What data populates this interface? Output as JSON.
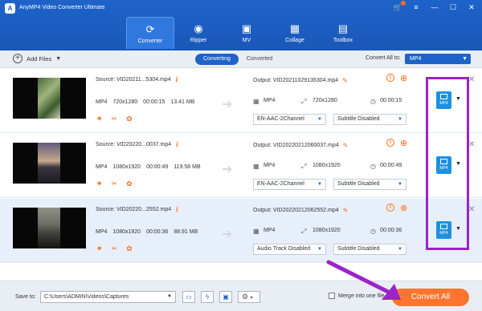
{
  "app": {
    "title": "AnyMP4 Video Converter Ultimate"
  },
  "nav": {
    "tabs": [
      {
        "label": "Converter",
        "icon": "converter-icon",
        "glyph": "⟳"
      },
      {
        "label": "Ripper",
        "icon": "disc-icon",
        "glyph": "◉"
      },
      {
        "label": "MV",
        "icon": "mv-icon",
        "glyph": "▣"
      },
      {
        "label": "Collage",
        "icon": "collage-icon",
        "glyph": "▦"
      },
      {
        "label": "Toolbox",
        "icon": "toolbox-icon",
        "glyph": "▤"
      }
    ]
  },
  "toolbar": {
    "add_files": "Add Files",
    "modes": [
      "Converting",
      "Converted"
    ],
    "convert_all_to_label": "Convert All to:",
    "convert_all_to_value": "MP4"
  },
  "files": [
    {
      "source": "Source: VID20211...5304.mp4",
      "format": "MP4",
      "resolution": "720x1280",
      "duration": "00:00:15",
      "size": "13.41 MB",
      "output": "Output: VID20211029135304.mp4",
      "out_format": "MP4",
      "out_resolution": "720x1280",
      "out_duration": "00:00:15",
      "audio": "EN-AAC-2Channel",
      "subtitle": "Subtitle Disabled",
      "format_badge": "MP4"
    },
    {
      "source": "Source: VID20220...0037.mp4",
      "format": "MP4",
      "resolution": "1080x1920",
      "duration": "00:00:49",
      "size": "119.58 MB",
      "output": "Output: VID20220212060037.mp4",
      "out_format": "MP4",
      "out_resolution": "1080x1920",
      "out_duration": "00:00:49",
      "audio": "EN-AAC-2Channel",
      "subtitle": "Subtitle Disabled",
      "format_badge": "MP4"
    },
    {
      "source": "Source: VID20220...2552.mp4",
      "format": "MP4",
      "resolution": "1080x1920",
      "duration": "00:00:36",
      "size": "88.91 MB",
      "output": "Output: VID20220212062552.mp4",
      "out_format": "MP4",
      "out_resolution": "1080x1920",
      "out_duration": "00:00:36",
      "audio": "Audio Track Disabled",
      "subtitle": "Subtitle Disabled",
      "format_badge": "MP4"
    }
  ],
  "bottom": {
    "save_to_label": "Save to:",
    "save_path": "C:\\Users\\ADMIN\\Videos\\Captures",
    "merge_label": "Merge into one file",
    "convert_all": "Convert All"
  },
  "colors": {
    "accent": "#1e63c9",
    "convert_button": "#ff7530",
    "highlight": "#9b24c8",
    "icon_orange": "#ff6a1a"
  }
}
